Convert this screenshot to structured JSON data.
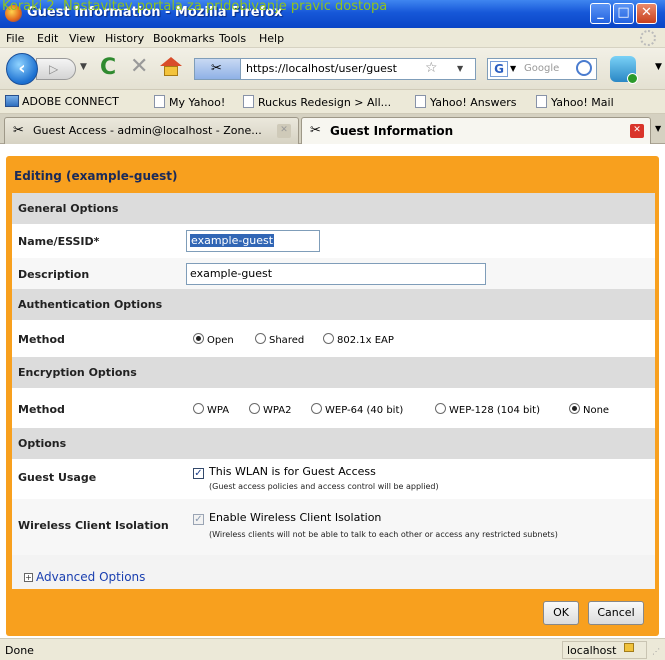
{
  "caption": "Koraki 2. Nastavitev portala za pridobivanje pravic dostopa",
  "window": {
    "title": "Guest Information - Mozilla Firefox"
  },
  "menu": [
    "File",
    "Edit",
    "View",
    "History",
    "Bookmarks",
    "Tools",
    "Help"
  ],
  "nav": {
    "url": "https://localhost/user/guest",
    "search_placeholder": "Google"
  },
  "bookmarks": [
    "ADOBE CONNECT",
    "My Yahoo!",
    "Ruckus Redesign > All...",
    "Yahoo! Answers",
    "Yahoo! Mail"
  ],
  "tabs": [
    {
      "label": "Guest Access - admin@localhost - Zone..."
    },
    {
      "label": "Guest Information"
    }
  ],
  "form": {
    "title": "Editing (example-guest)",
    "sections": {
      "general": "General Options",
      "auth": "Authentication Options",
      "enc": "Encryption Options",
      "options": "Options"
    },
    "labels": {
      "name": "Name/ESSID*",
      "description": "Description",
      "auth_method": "Method",
      "enc_method": "Method",
      "guest_usage": "Guest Usage",
      "isolation": "Wireless Client Isolation"
    },
    "values": {
      "name": "example-guest",
      "description": "example-guest"
    },
    "auth_options": [
      "Open",
      "Shared",
      "802.1x EAP"
    ],
    "auth_selected": "Open",
    "enc_options": [
      "WPA",
      "WPA2",
      "WEP-64 (40 bit)",
      "WEP-128 (104 bit)",
      "None"
    ],
    "enc_selected": "None",
    "guest_usage_label": "This WLAN is for Guest Access",
    "guest_usage_note": "(Guest access policies and access control will be applied)",
    "isolation_label": "Enable Wireless Client Isolation",
    "isolation_note": "(Wireless clients will not be able to talk to each other or access any restricted subnets)",
    "advanced": "Advanced Options",
    "ok": "OK",
    "cancel": "Cancel"
  },
  "status": {
    "text": "Done",
    "host": "localhost"
  }
}
